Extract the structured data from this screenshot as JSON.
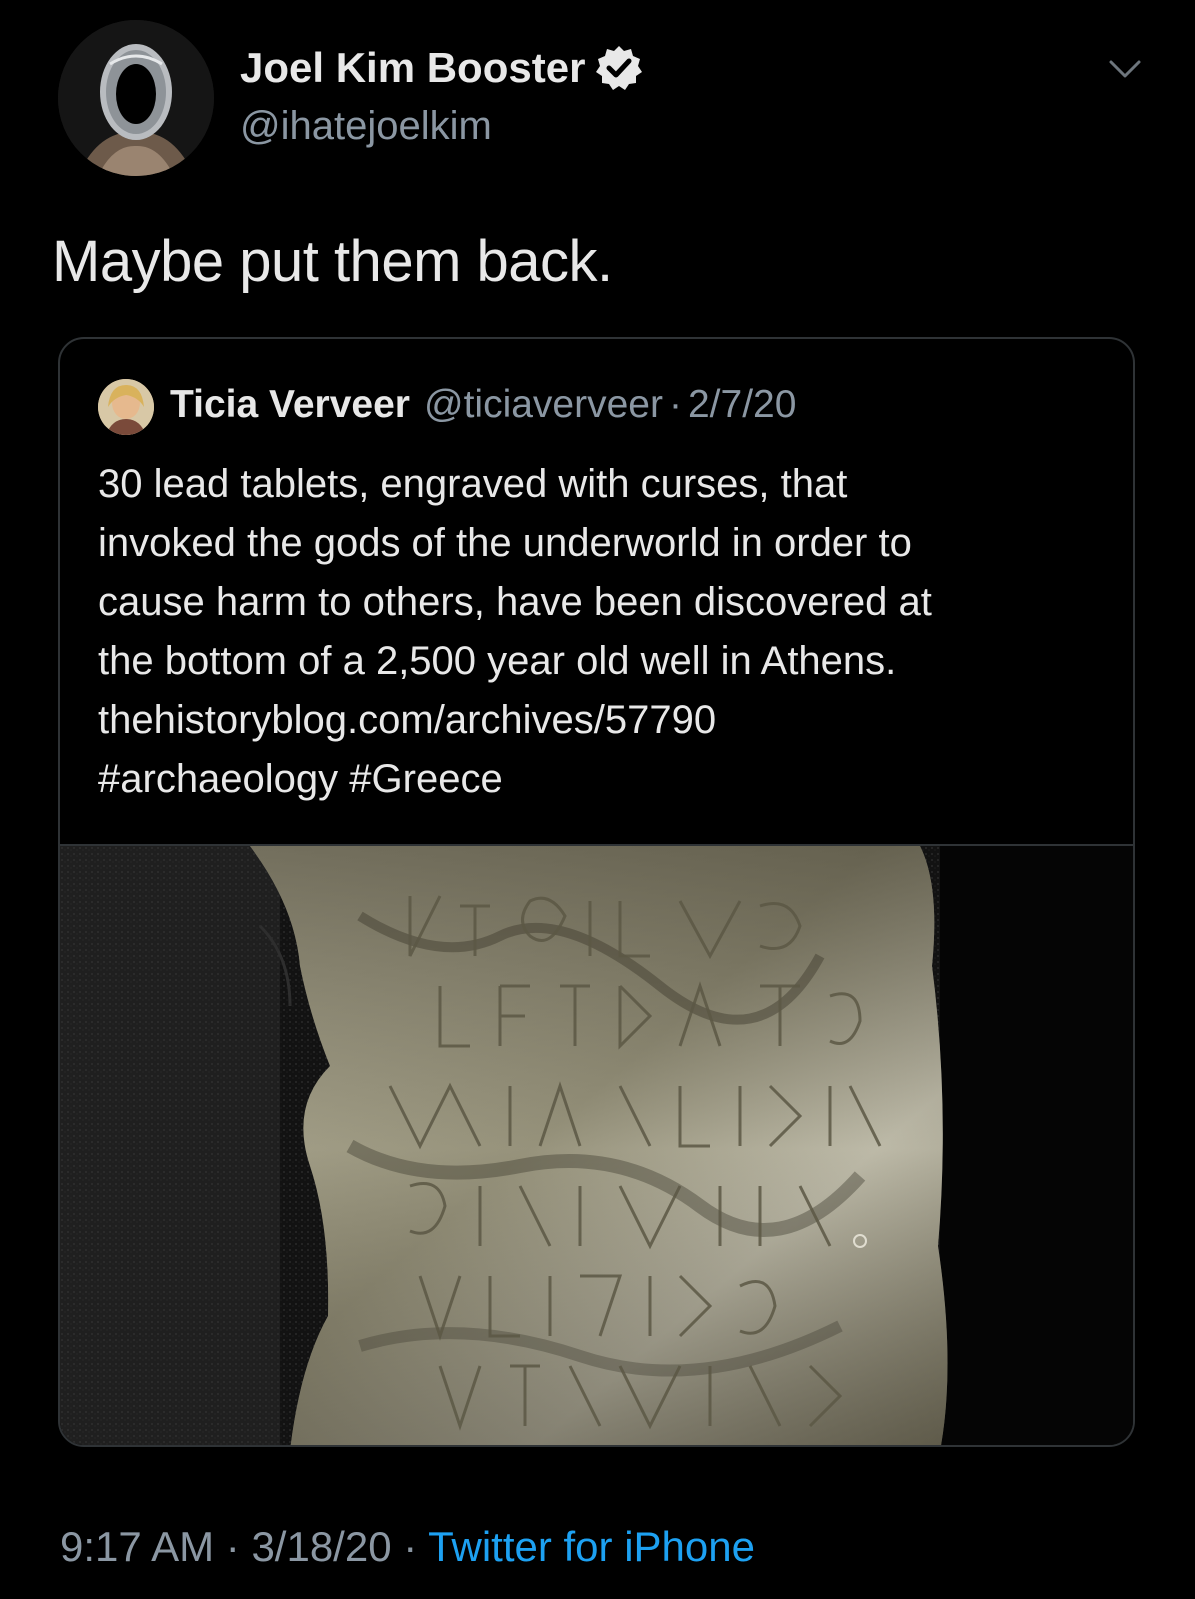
{
  "author": {
    "display_name": "Joel Kim Booster",
    "handle": "@ihatejoelkim",
    "verified": true,
    "avatar_icon": "profile-photo"
  },
  "tweet": {
    "text": "Maybe put them back."
  },
  "quote": {
    "display_name": "Ticia Verveer",
    "handle": "@ticiaverveer",
    "date": "2/7/20",
    "separator": "·",
    "lines": [
      "30 lead tablets, engraved with curses, that",
      "invoked the gods of the underworld in order to",
      "cause harm to others, have been discovered at",
      "the bottom of a 2,500 year old well in Athens.",
      "thehistoryblog.com/archives/57790",
      "#archaeology #Greece"
    ],
    "media_icon": "lead-tablet-photo"
  },
  "footer": {
    "time": "9:17 AM",
    "date": "3/18/20",
    "sep1": " · ",
    "sep2": " · ",
    "source": "Twitter for iPhone"
  },
  "colors": {
    "background": "#000000",
    "text": "#e8e8e8",
    "muted": "#8b97a3",
    "link": "#1da1f2",
    "border": "#2f3336"
  }
}
